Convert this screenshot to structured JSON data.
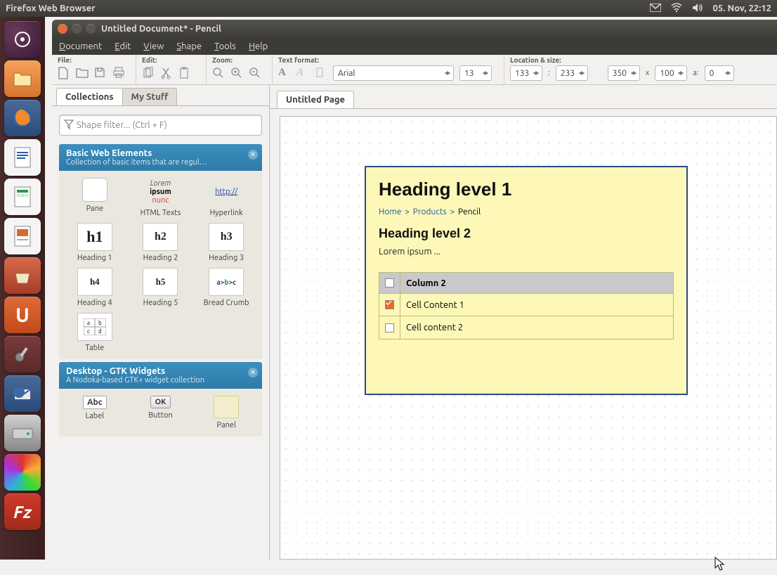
{
  "panel": {
    "title": "Firefox Web Browser",
    "clock": "05. Nov, 22:12"
  },
  "window": {
    "title": "Untitled Document* - Pencil"
  },
  "menu": {
    "document": "Document",
    "edit": "Edit",
    "view": "View",
    "shape": "Shape",
    "tools": "Tools",
    "help": "Help"
  },
  "toolbar": {
    "file_label": "File:",
    "edit_label": "Edit:",
    "zoom_label": "Zoom:",
    "text_label": "Text format:",
    "loc_label": "Location & size:",
    "font": "Arial",
    "fontsize": "13",
    "x": "133",
    "y": "233",
    "w": "350",
    "h": "100",
    "a_label": "a:",
    "a": "0",
    "x_sep": "x",
    "colon": ":"
  },
  "sidebar": {
    "tab_collections": "Collections",
    "tab_mystuff": "My Stuff",
    "filter_placeholder": "Shape filter... (Ctrl + F)",
    "cat1_name": "Basic Web Elements",
    "cat1_desc": "Collection of basic items that are regul…",
    "cat2_name": "Desktop - GTK Widgets",
    "cat2_desc": "A Nodoka-based GTK+ widget collection",
    "shapes": {
      "pane": "Pane",
      "html": "HTML Texts",
      "hyper": "Hyperlink",
      "h1": "Heading 1",
      "h2": "Heading 2",
      "h3": "Heading 3",
      "h4": "Heading 4",
      "h5": "Heading 5",
      "bc": "Bread Crumb",
      "table": "Table",
      "label": "Label",
      "button": "Button",
      "panel": "Panel"
    },
    "thumbs": {
      "lorem1": "Lorem",
      "lorem2": "ipsum",
      "lorem3": "nunc",
      "link": "http://",
      "h1": "h1",
      "h2": "h2",
      "h3": "h3",
      "h4": "h4",
      "h5": "h5",
      "bc_a": "a",
      "bc_g": ">",
      "bc_b": "b",
      "bc_c": "c",
      "abc": "Abc",
      "ok": "OK"
    }
  },
  "page_tab": "Untitled Page",
  "canvas": {
    "h1": "Heading level 1",
    "bc_home": "Home",
    "bc_products": "Products",
    "bc_current": "Pencil",
    "bc_sep": ">",
    "h2": "Heading level 2",
    "para": "Lorem ipsum ...",
    "col2": "Column 2",
    "cell1": "Cell Content 1",
    "cell2": "Cell content 2"
  }
}
